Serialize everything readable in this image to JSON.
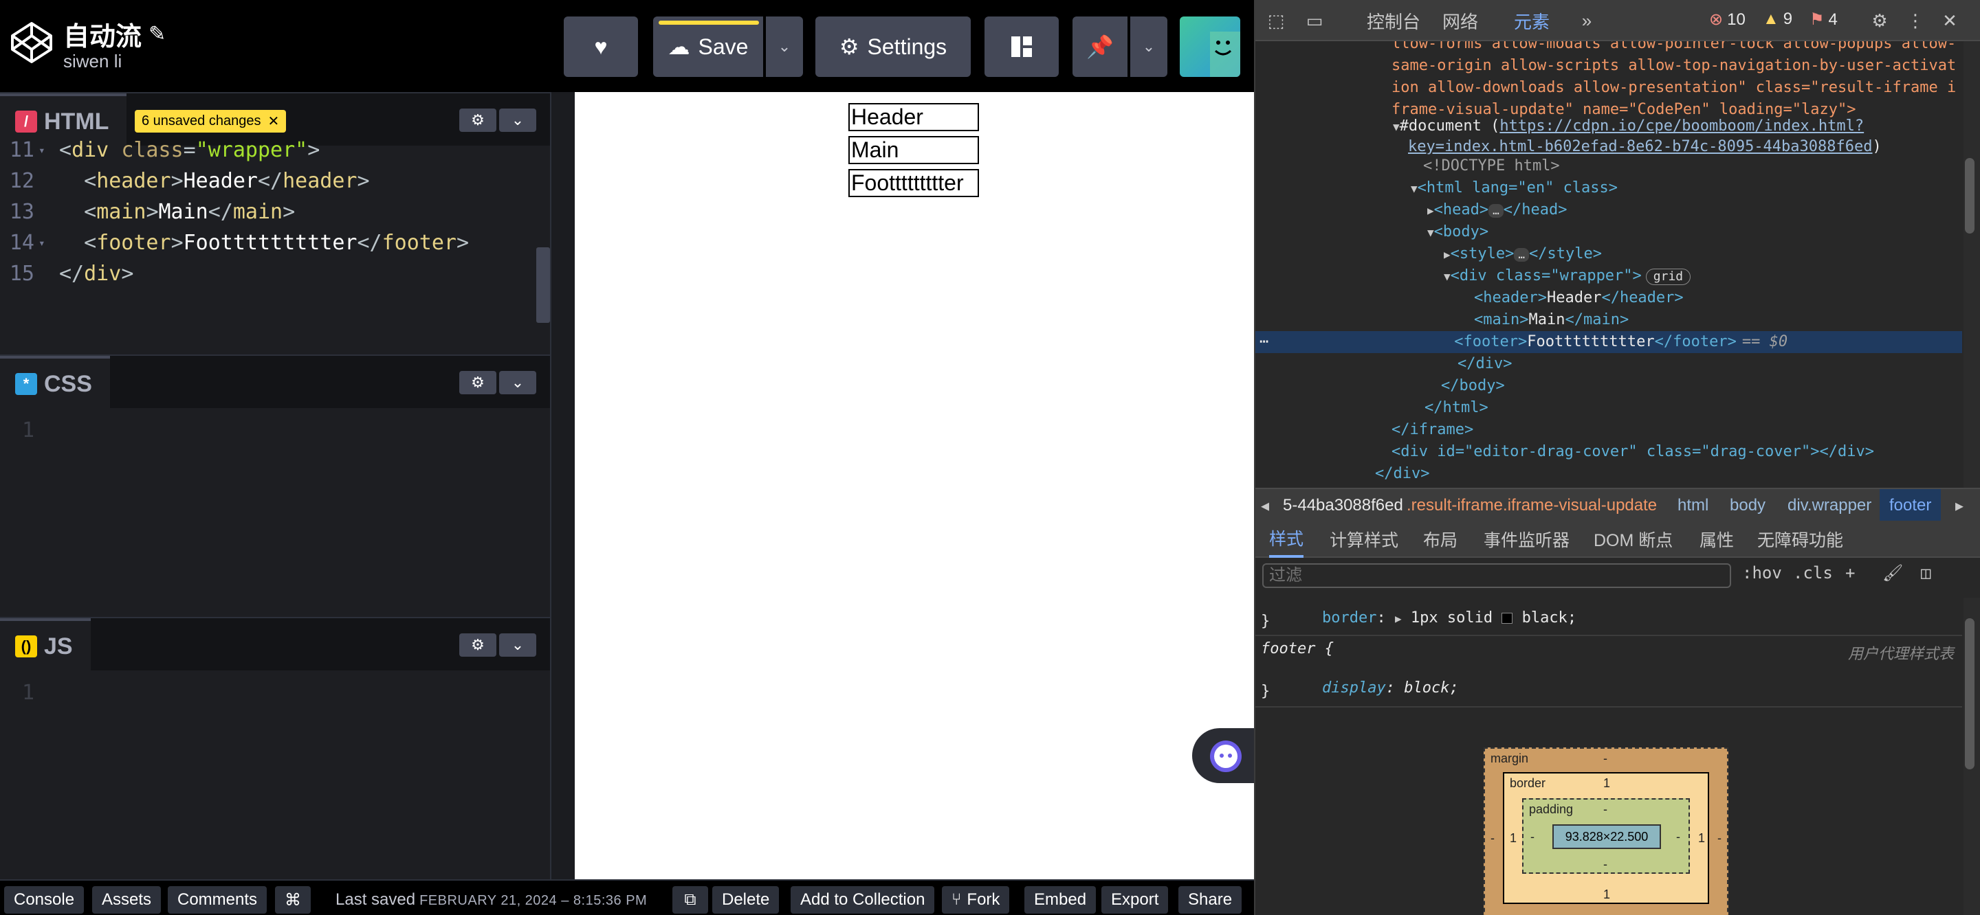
{
  "header": {
    "title": "自动流",
    "author": "siwen li",
    "save_label": "Save",
    "settings_label": "Settings"
  },
  "editors": {
    "html": {
      "label": "HTML",
      "unsaved_badge": "6 unsaved changes",
      "lines": [
        {
          "n": "11",
          "tag": "div",
          "attr": "class",
          "val": "\"wrapper\""
        },
        {
          "n": "12",
          "text": "Header",
          "tag": "header"
        },
        {
          "n": "13",
          "text": "Main",
          "tag": "main"
        },
        {
          "n": "14",
          "text": "Foottttttttter",
          "tag": "footer"
        },
        {
          "n": "15",
          "close": "div"
        }
      ]
    },
    "css": {
      "label": "CSS",
      "line": "1"
    },
    "js": {
      "label": "JS",
      "line": "1"
    }
  },
  "preview": {
    "header_text": "Header",
    "main_text": "Main",
    "footer_text": "Foottttttttter"
  },
  "footer": {
    "console": "Console",
    "assets": "Assets",
    "comments": "Comments",
    "shortcut": "⌘",
    "last_saved_label": "Last saved",
    "last_saved_date": "FEBRUARY 21, 2024 – 8:15:36 PM",
    "delete": "Delete",
    "add_to_collection": "Add to Collection",
    "fork": "Fork",
    "embed": "Embed",
    "export": "Export",
    "share": "Share"
  },
  "devtools": {
    "tabs": [
      "控制台",
      "网络",
      "元素"
    ],
    "active_tab": "元素",
    "errors": "10",
    "warnings": "9",
    "issues": "4",
    "dom": {
      "attr_line1": "llow-forms allow-modals allow-pointer-lock allow-popups allow-",
      "attr_line2": "same-origin allow-scripts allow-top-navigation-by-user-activat",
      "attr_line3": "ion allow-downloads allow-presentation\" class=\"result-iframe i",
      "attr_line4": "frame-visual-update\" name=\"CodePen\" loading=\"lazy\">",
      "document_label": "#document (",
      "document_url1": "https://cdpn.io/cpe/boomboom/index.html?",
      "document_url2": "key=index.html-b602efad-8e62-b74c-8095-44ba3088f6ed",
      "doctype": "<!DOCTYPE html>",
      "html_open": "<html lang=\"en\" class>",
      "head": "<head>",
      "head_close": "</head>",
      "body_open": "<body>",
      "style_open": "<style>",
      "style_close": "</style>",
      "wrapper_open": "<div class=\"wrapper\">",
      "grid_badge": "grid",
      "header_line": "Header",
      "main_line": "Main",
      "footer_line": "Foottttttttter",
      "selected_marker": "== $0",
      "div_close": "</div>",
      "body_close": "</body>",
      "html_close": "</html>",
      "iframe_close": "</iframe>",
      "drag_cover": "<div id=\"editor-drag-cover\" class=\"drag-cover\"></div>",
      "div_close2": "</div>"
    },
    "breadcrumbs": [
      "5-44ba3088f6ed",
      ".result-iframe.iframe-visual-update",
      "html",
      "body",
      "div.wrapper",
      "footer"
    ],
    "sub_tabs": [
      "样式",
      "计算样式",
      "布局",
      "事件监听器",
      "DOM 断点",
      "属性",
      "无障碍功能"
    ],
    "filter_placeholder": "过滤",
    "hov": ":hov",
    "cls": ".cls",
    "styles": {
      "border_prop": "border",
      "border_val": "1px solid",
      "border_color": "black",
      "footer_selector": "footer {",
      "ua_label": "用户代理样式表",
      "display_prop": "display",
      "display_val": "block"
    },
    "box_model": {
      "margin_label": "margin",
      "margin_val": "-",
      "border_label": "border",
      "border_val": "1",
      "padding_label": "padding",
      "padding_val": "-",
      "content": "93.828×22.500"
    }
  }
}
